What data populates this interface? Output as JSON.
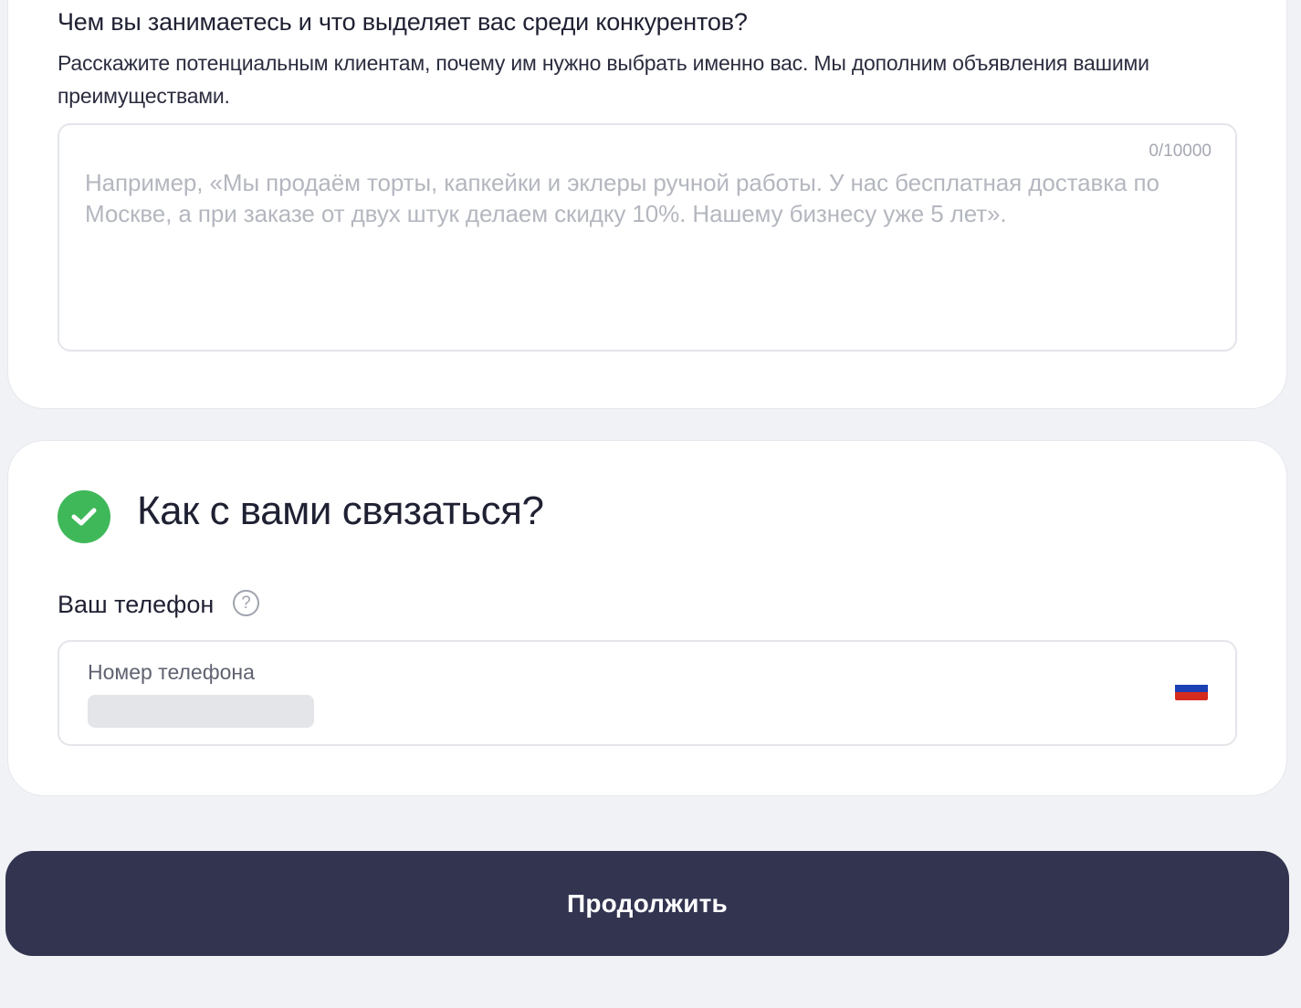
{
  "about_section": {
    "question": "Чем вы занимаетесь и что выделяет вас среди конкурентов?",
    "description": "Расскажите потенциальным клиентам, почему им нужно выбрать именно вас. Мы дополним объявления вашими преимуществами.",
    "textarea": {
      "value": "",
      "placeholder": "Например, «Мы продаём торты, капкейки и эклеры ручной работы. У нас бесплатная доставка по Москве, а при заказе от двух штук делаем скидку 10%. Нашему бизнесу уже 5 лет».",
      "counter": "0/10000"
    }
  },
  "contact_section": {
    "status_icon": "check-circle-icon",
    "title": "Как с вами связаться?",
    "phone_label": "Ваш телефон",
    "help_icon": "question-circle-icon",
    "help_glyph": "?",
    "phone_field": {
      "placeholder": "Номер телефона",
      "country_flag": "ru-flag-icon",
      "flag_colors": [
        "#ffffff",
        "#1c3fb4",
        "#d52b1e"
      ]
    }
  },
  "continue_button": {
    "label": "Продолжить"
  },
  "colors": {
    "page_bg": "#f1f2f5",
    "card_bg": "#ffffff",
    "accent_green": "#3fb85a",
    "button_bg": "#323450",
    "button_text": "#ffffff"
  }
}
